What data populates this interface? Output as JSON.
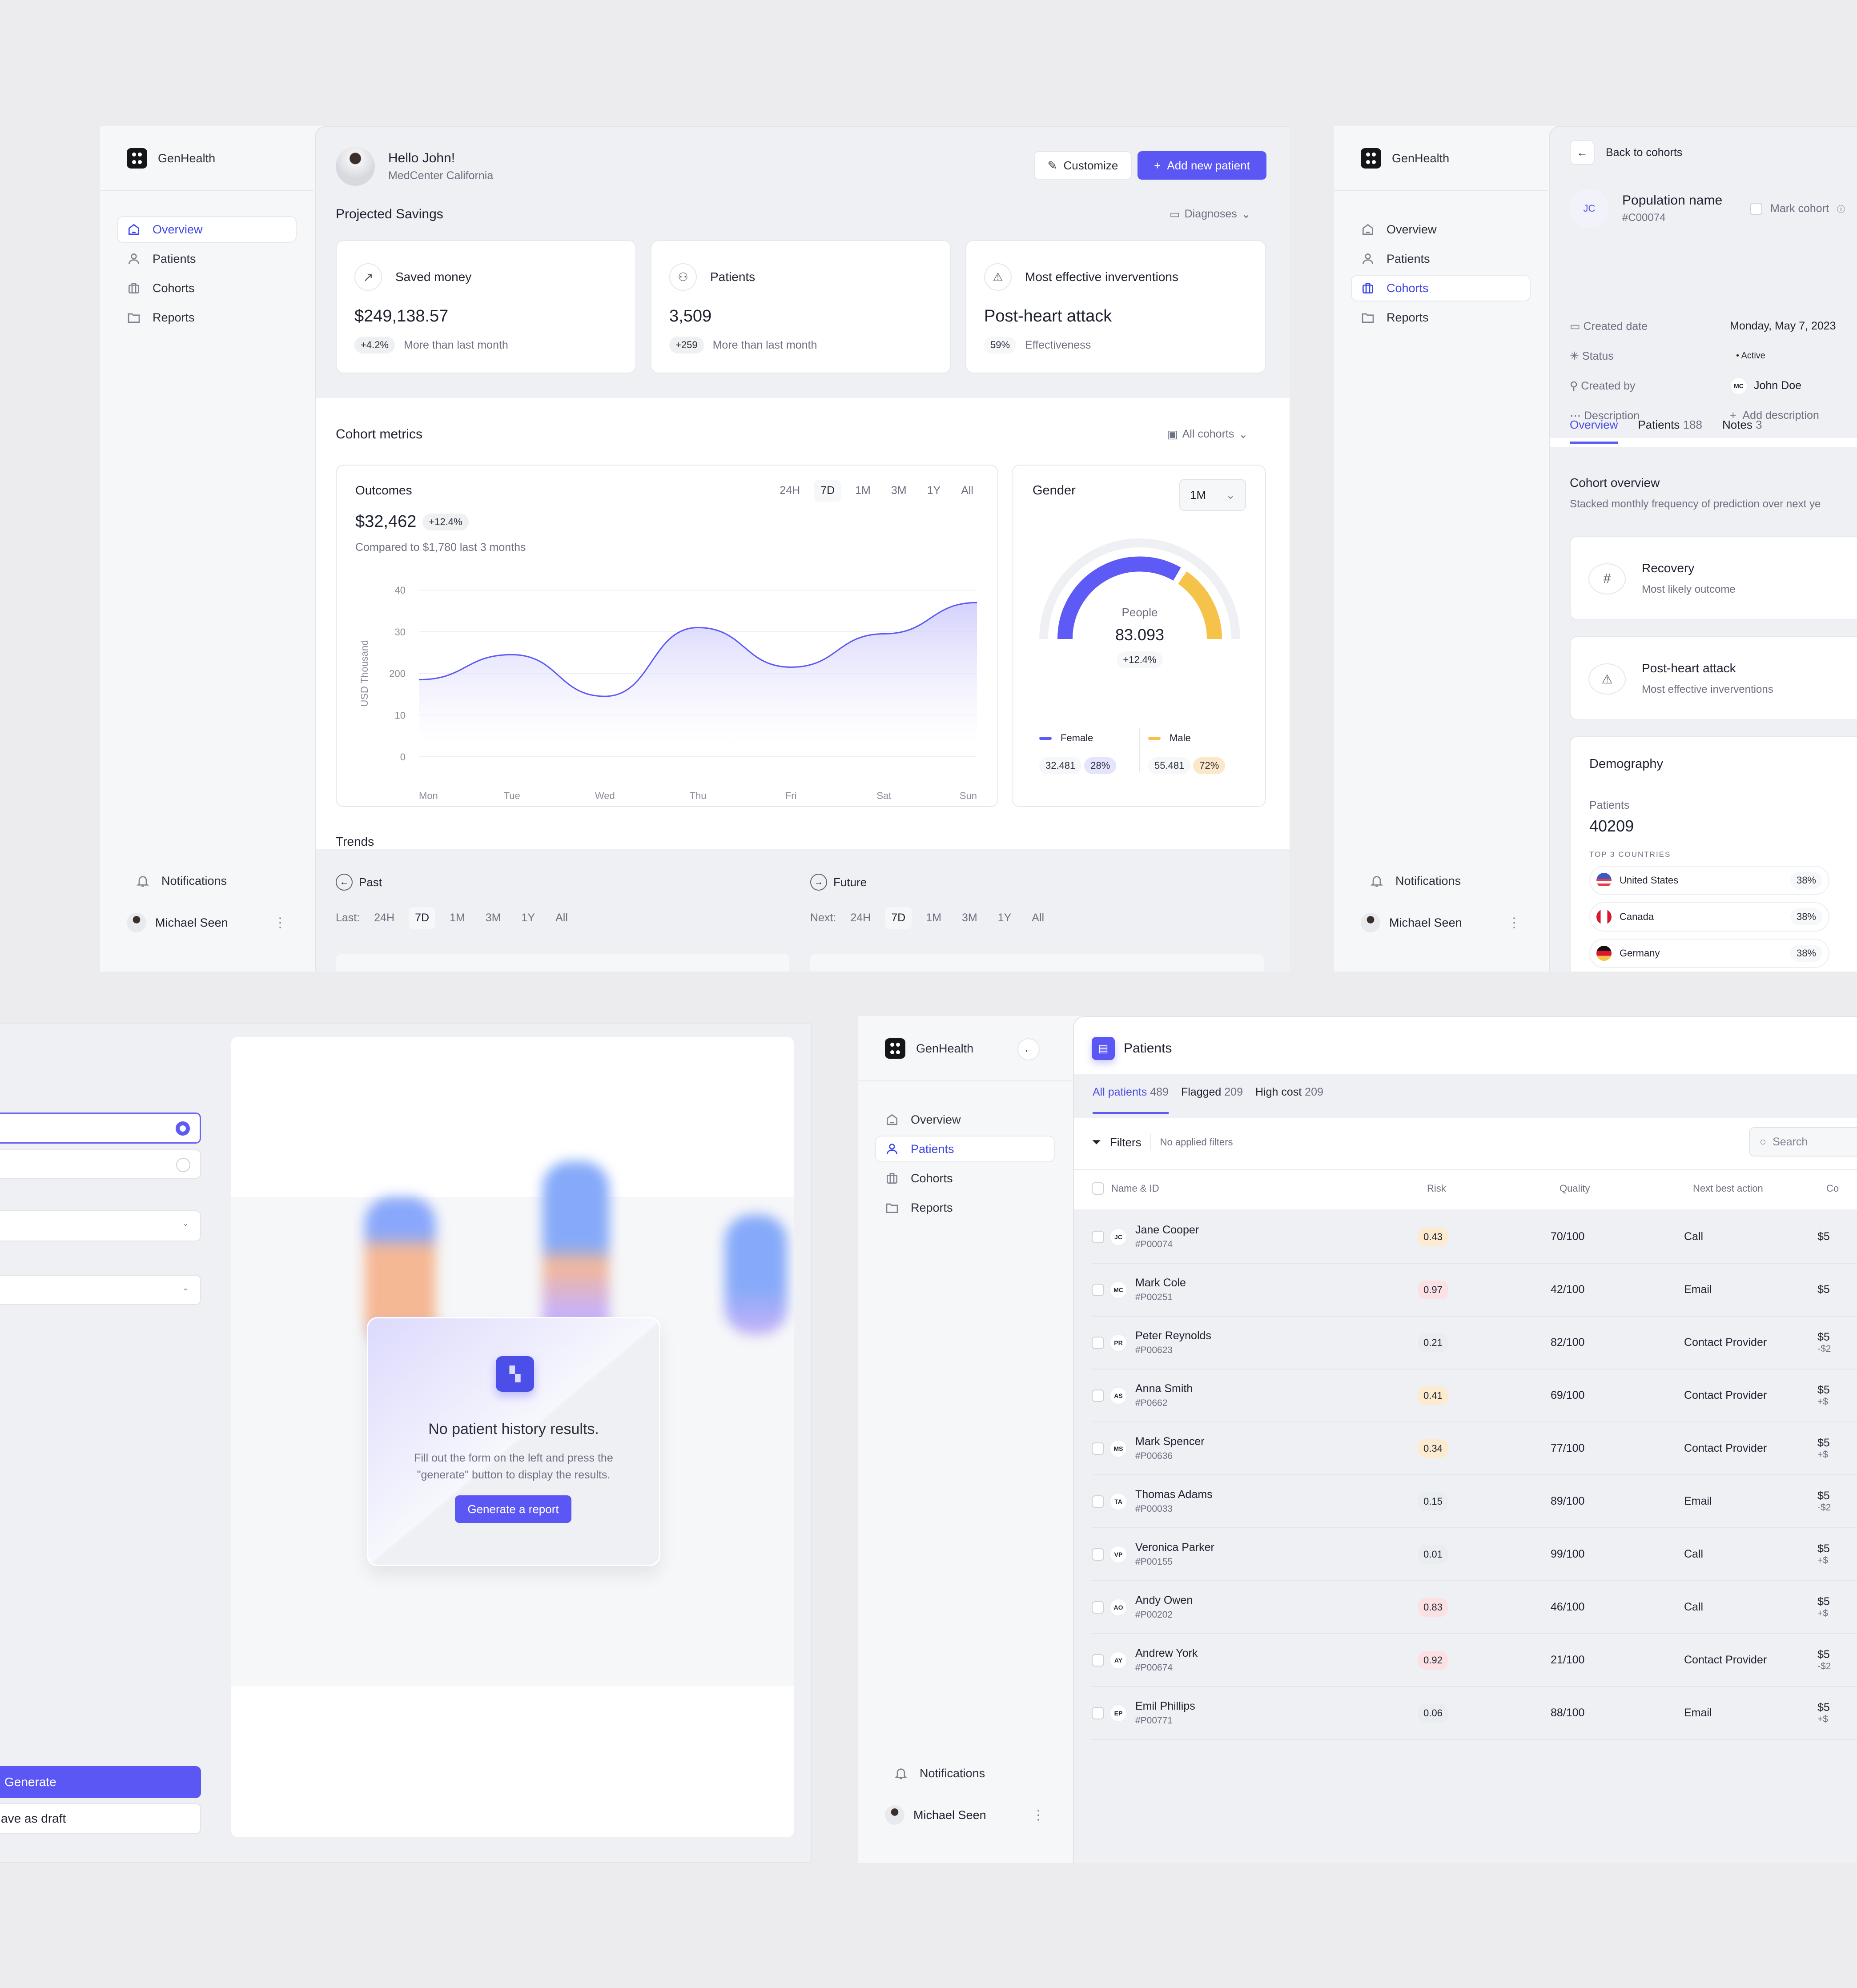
{
  "app": {
    "name": "GenHealth"
  },
  "nav": {
    "items": [
      {
        "label": "Overview",
        "icon": "home-icon"
      },
      {
        "label": "Patients",
        "icon": "user-icon"
      },
      {
        "label": "Cohorts",
        "icon": "briefcase-icon"
      },
      {
        "label": "Reports",
        "icon": "folder-icon"
      }
    ],
    "notifications": "Notifications",
    "user": "Michael Seen"
  },
  "dashboard": {
    "greeting": "Hello John!",
    "org": "MedCenter California",
    "customize": "Customize",
    "add_patient": "Add new patient",
    "projected_title": "Projected Savings",
    "diagnoses": "Diagnoses",
    "stats": [
      {
        "title": "Saved money",
        "value": "$249,138.57",
        "badge": "+4.2%",
        "note": "More than last month"
      },
      {
        "title": "Patients",
        "value": "3,509",
        "badge": "+259",
        "note": "More than last month"
      },
      {
        "title": "Most effective inverventions",
        "value": "Post-heart attack",
        "badge": "59%",
        "note": "Effectiveness"
      }
    ],
    "cohort_metrics": "Cohort metrics",
    "all_cohorts": "All cohorts",
    "outcomes": {
      "title": "Outcomes",
      "value": "$32,462",
      "change": "+12.4%",
      "compare": "Compared to $1,780 last 3 months",
      "ranges": [
        "24H",
        "7D",
        "1M",
        "3M",
        "1Y",
        "All"
      ],
      "active_range": "7D"
    },
    "gender": {
      "title": "Gender",
      "period": "1M",
      "center_label": "People",
      "total": "83.093",
      "change": "+12.4%",
      "female": {
        "label": "Female",
        "count": "32.481",
        "pct": "28%"
      },
      "male": {
        "label": "Male",
        "count": "55.481",
        "pct": "72%"
      }
    },
    "trends": {
      "title": "Trends",
      "past": "Past",
      "future": "Future",
      "last_label": "Last:",
      "next_label": "Next:",
      "ranges": [
        "24H",
        "7D",
        "1M",
        "3M",
        "1Y",
        "All"
      ]
    }
  },
  "chart_data": {
    "type": "area",
    "title": "Outcomes",
    "xlabel": "",
    "ylabel": "USD Thousand",
    "categories": [
      "Mon",
      "Tue",
      "Wed",
      "Thu",
      "Fri",
      "Sat",
      "Sun"
    ],
    "y_tick_labels": [
      "0",
      "10",
      "200",
      "30",
      "40"
    ],
    "ylim": [
      0,
      40
    ],
    "series": [
      {
        "name": "Outcomes",
        "values": [
          18.5,
          24.5,
          14.5,
          31,
          21.5,
          29.5,
          37
        ]
      }
    ],
    "grid": true
  },
  "cohort": {
    "back": "Back to cohorts",
    "initials": "JC",
    "name": "Population name",
    "id": "#C00074",
    "mark": "Mark cohort",
    "fields": [
      {
        "label": "Created date",
        "value": "Monday, May 7, 2023"
      },
      {
        "label": "Status",
        "value": "Active"
      },
      {
        "label": "Created by",
        "value": "John Doe",
        "initials": "MC"
      },
      {
        "label": "Description",
        "value": "Add description"
      }
    ],
    "tabs": [
      {
        "label": "Overview",
        "count": ""
      },
      {
        "label": "Patients",
        "count": "188"
      },
      {
        "label": "Notes",
        "count": "3"
      }
    ],
    "overview_title": "Cohort overview",
    "overview_sub": "Stacked monthly frequency of prediction over next ye",
    "insights": [
      {
        "title": "Recovery",
        "sub": "Most likely outcome"
      },
      {
        "title": "Post-heart attack",
        "sub": "Most effective inverventions"
      }
    ],
    "demography": {
      "title": "Demography",
      "patients_label": "Patients",
      "patients": "40209",
      "top_label": "TOP 3 COUNTRIES",
      "countries": [
        {
          "name": "United States",
          "pct": "38%"
        },
        {
          "name": "Canada",
          "pct": "38%"
        },
        {
          "name": "Germany",
          "pct": "38%"
        }
      ]
    }
  },
  "report": {
    "empty_title": "No patient history results.",
    "empty_sub1": "Fill out the form on the left and press the",
    "empty_sub2": "\"generate\" button to display the results.",
    "generate_report": "Generate a report",
    "generate": "Generate",
    "save_draft": "ave as draft"
  },
  "patients": {
    "title": "Patients",
    "tabs": [
      {
        "label": "All patients",
        "count": "489"
      },
      {
        "label": "Flagged",
        "count": "209"
      },
      {
        "label": "High cost",
        "count": "209"
      }
    ],
    "filters": "Filters",
    "no_filters": "No applied filters",
    "search_placeholder": "Search",
    "columns": [
      "Name & ID",
      "Risk",
      "Quality",
      "Next best action",
      "Co"
    ],
    "rows": [
      {
        "initials": "JC",
        "name": "Jane Cooper",
        "id": "#P00074",
        "risk": "0.43",
        "level": "mid",
        "quality": "70/100",
        "action": "Call",
        "cost": "$5",
        "delta": ""
      },
      {
        "initials": "MC",
        "name": "Mark Cole",
        "id": "#P00251",
        "risk": "0.97",
        "level": "high",
        "quality": "42/100",
        "action": "Email",
        "cost": "$5",
        "delta": ""
      },
      {
        "initials": "PR",
        "name": "Peter Reynolds",
        "id": "#P00623",
        "risk": "0.21",
        "level": "low",
        "quality": "82/100",
        "action": "Contact Provider",
        "cost": "$5",
        "delta": "-$2"
      },
      {
        "initials": "AS",
        "name": "Anna Smith",
        "id": "#P0662",
        "risk": "0.41",
        "level": "mid",
        "quality": "69/100",
        "action": "Contact Provider",
        "cost": "$5",
        "delta": "+$"
      },
      {
        "initials": "MS",
        "name": "Mark Spencer",
        "id": "#P00636",
        "risk": "0.34",
        "level": "mid",
        "quality": "77/100",
        "action": "Contact Provider",
        "cost": "$5",
        "delta": "+$"
      },
      {
        "initials": "TA",
        "name": "Thomas Adams",
        "id": "#P00033",
        "risk": "0.15",
        "level": "low",
        "quality": "89/100",
        "action": "Email",
        "cost": "$5",
        "delta": "-$2"
      },
      {
        "initials": "VP",
        "name": "Veronica Parker",
        "id": "#P00155",
        "risk": "0.01",
        "level": "low",
        "quality": "99/100",
        "action": "Call",
        "cost": "$5",
        "delta": "+$"
      },
      {
        "initials": "AO",
        "name": "Andy Owen",
        "id": "#P00202",
        "risk": "0.83",
        "level": "high",
        "quality": "46/100",
        "action": "Call",
        "cost": "$5",
        "delta": "+$"
      },
      {
        "initials": "AY",
        "name": "Andrew York",
        "id": "#P00674",
        "risk": "0.92",
        "level": "high",
        "quality": "21/100",
        "action": "Contact Provider",
        "cost": "$5",
        "delta": "-$2"
      },
      {
        "initials": "EP",
        "name": "Emil Phillips",
        "id": "#P00771",
        "risk": "0.06",
        "level": "low",
        "quality": "88/100",
        "action": "Email",
        "cost": "$5",
        "delta": "+$"
      }
    ]
  },
  "colors": {
    "accent": "#5b57f5",
    "male": "#f5c34a",
    "risk_high": "#fbe1e4",
    "risk_mid": "#fcebcf",
    "risk_low": "#e9edef"
  }
}
